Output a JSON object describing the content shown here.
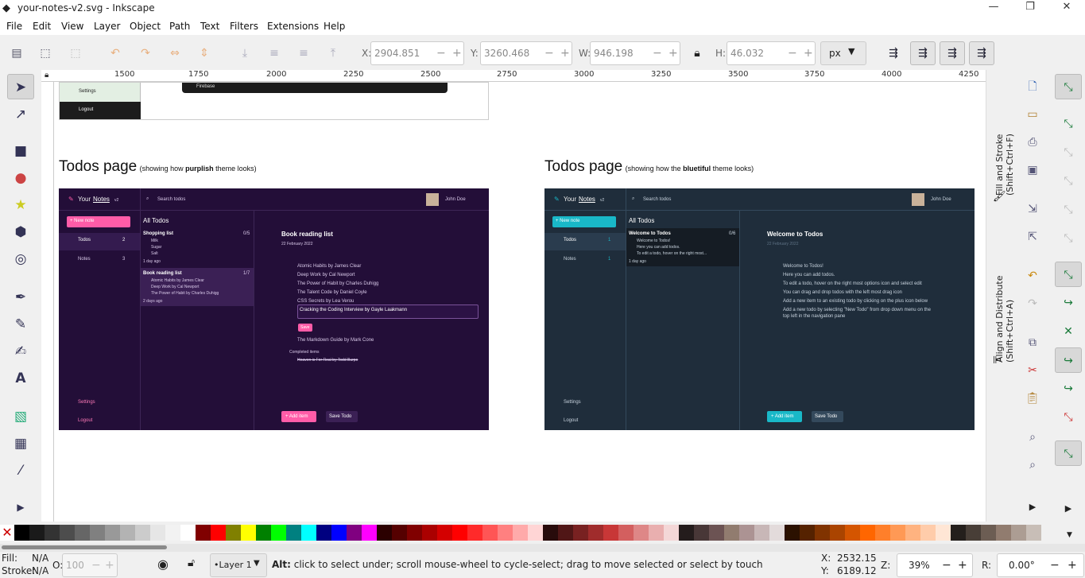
{
  "window": {
    "title": "your-notes-v2.svg - Inkscape",
    "min": "—",
    "max": "❐",
    "close": "✕"
  },
  "menu": [
    "File",
    "Edit",
    "View",
    "Layer",
    "Object",
    "Path",
    "Text",
    "Filters",
    "Extensions",
    "Help"
  ],
  "fields": {
    "x_label": "X:",
    "x": "2904.851",
    "y_label": "Y:",
    "y": "3260.468",
    "w_label": "W:",
    "w": "946.198",
    "h_label": "H:",
    "h": "46.032",
    "unit": "px"
  },
  "ruler": [
    "1500",
    "1750",
    "2000",
    "2250",
    "2500",
    "2750",
    "3000",
    "3250",
    "3500",
    "3750",
    "4000",
    "4250"
  ],
  "panels": {
    "fill_stroke": "Fill and Stroke (Shift+Ctrl+F)",
    "align": "Align and Distribute (Shift+Ctrl+A)"
  },
  "canvas": {
    "top_settings": "Settings",
    "top_logout": "Logout",
    "top_firebase": "Firebase",
    "left_heading": "Todos page",
    "left_note_a": "(showing how ",
    "left_note_b": "purplish",
    "left_note_c": " theme looks)",
    "right_heading": "Todos page",
    "right_note_a": "(showing how the ",
    "right_note_b": "bluetiful",
    "right_note_c": " theme looks)",
    "purple": {
      "brand_a": "Your ",
      "brand_b": "Notes",
      "brand_v": "v2",
      "search": "Search todos",
      "user": "John Doe",
      "new_note": "+ New note",
      "nav": [
        {
          "label": "Todos",
          "count": "2"
        },
        {
          "label": "Notes",
          "count": "3"
        }
      ],
      "all_todos": "All Todos",
      "lists": [
        {
          "title": "Shopping list",
          "count": "0/5",
          "items": [
            "Milk",
            "Sugar",
            "Salt"
          ],
          "age": "1 day ago"
        },
        {
          "title": "Book reading list",
          "count": "1/7",
          "items": [
            "Atomic Habits by James Clear",
            "Deep Work by Cal Newport",
            "The Power of Habit by Charles Duhigg"
          ],
          "age": "2 days ago"
        }
      ],
      "detail_title": "Book  reading list",
      "detail_date": "22 February 2022",
      "todos": [
        "Atomic Habits by James Clear",
        "Deep Work by Cal Newport",
        "The Power of Habit by Charles Duhigg",
        "The Talent Code by Daniel Coyle",
        "CSS Secrets by Lea Verou"
      ],
      "editing": "Cracking the Coding Interview by Gayle Laakmann",
      "save": "Save",
      "last": "The Markdown Guide by Mark Cone",
      "completed": "Completed items",
      "done": "Heaven is For Real by Todd Burpo",
      "settings": "Settings",
      "logout": "Logout",
      "add_item": "+ Add item",
      "save_todo": "Save Todo"
    },
    "blue": {
      "brand_a": "Your ",
      "brand_b": "Notes",
      "brand_v": "v2",
      "search": "Search todos",
      "user": "John Doe",
      "new_note": "+ New note",
      "nav": [
        {
          "label": "Todos",
          "count": "1"
        },
        {
          "label": "Notes",
          "count": "1"
        }
      ],
      "all_todos": "All Todos",
      "list": {
        "title": "Welcome to Todos",
        "count": "0/6",
        "items": [
          "Welcome to Todos!",
          "Here you can add todos.",
          "To edit a todo, hover on the right most..."
        ],
        "age": "1 day ago"
      },
      "detail_title": "Welcome to Todos",
      "detail_date": "22 February 2022",
      "todos": [
        "Welcome to Todos!",
        "Here you can add todos.",
        "To edit a todo, hover on the right most options icon and select edit",
        "You can drag and drop todos with the left most drag icon",
        "Add a new item to an existing todo by clicking on the plus icon below",
        "Add a new todo by selecting \"New Todo\" from drop down menu on the",
        "top left in the navigation pane"
      ],
      "settings": "Settings",
      "logout": "Logout",
      "add_item": "+ Add item",
      "save_todo": "Save Todo"
    }
  },
  "palette": [
    "#000000",
    "#1a1a1a",
    "#333333",
    "#4d4d4d",
    "#666666",
    "#808080",
    "#999999",
    "#b3b3b3",
    "#cccccc",
    "#e6e6e6",
    "#f2f2f2",
    "#ffffff",
    "#800000",
    "#ff0000",
    "#808000",
    "#ffff00",
    "#008000",
    "#00ff00",
    "#008080",
    "#00ffff",
    "#000080",
    "#0000ff",
    "#800080",
    "#ff00ff",
    "#2b0000",
    "#550000",
    "#800000",
    "#aa0000",
    "#d40000",
    "#ff0000",
    "#ff2a2a",
    "#ff5555",
    "#ff8080",
    "#ffaaaa",
    "#ffd5d5",
    "#280b0b",
    "#501616",
    "#782121",
    "#a02c2c",
    "#c83737",
    "#d35f5f",
    "#de8787",
    "#e9afaf",
    "#f4d7d7",
    "#241c1c",
    "#483737",
    "#6c5353",
    "#917c6f",
    "#ac9393",
    "#c8b7b7",
    "#e3dbdb",
    "#2b1100",
    "#552200",
    "#803300",
    "#aa4400",
    "#d45500",
    "#ff6600",
    "#ff7f2a",
    "#ff9955",
    "#ffb380",
    "#ffccaa",
    "#ffe6d5",
    "#241f1c",
    "#483e37",
    "#6c5d53",
    "#917c6f",
    "#ac9d93",
    "#c8beb7"
  ],
  "status": {
    "fill_label": "Fill:",
    "fill": "N/A",
    "stroke_label": "Stroke:",
    "stroke": "N/A",
    "o_label": "O:",
    "o": "100",
    "layer": "•Layer 1",
    "hint_b": "Alt:",
    "hint": " click to select under; scroll mouse-wheel to cycle-select; drag to move selected or select by touch",
    "x_label": "X:",
    "x": "2532.15",
    "y_label": "Y:",
    "y": "6189.12",
    "z_label": "Z:",
    "zoom": "39%",
    "r_label": "R:",
    "rot": "0.00°"
  }
}
